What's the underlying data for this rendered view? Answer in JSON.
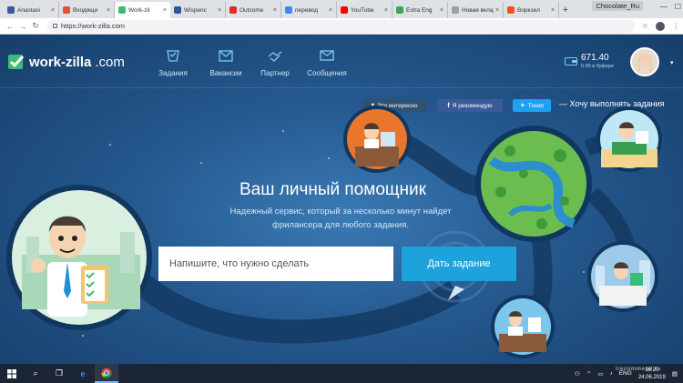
{
  "browser": {
    "tabs": [
      {
        "label": "Anastasi",
        "color": "#3b5998",
        "active": false
      },
      {
        "label": "Входящи",
        "color": "#e2503b",
        "active": false
      },
      {
        "label": "Work-zil",
        "color": "#3dbb76",
        "active": true
      },
      {
        "label": "Wispenc",
        "color": "#2b579a",
        "active": false
      },
      {
        "label": "Outcome",
        "color": "#d93025",
        "active": false
      },
      {
        "label": "перевод",
        "color": "#4285f4",
        "active": false
      },
      {
        "label": "YouTube",
        "color": "#ff0000",
        "active": false
      },
      {
        "label": "Extra Eng",
        "color": "#34a853",
        "active": false
      },
      {
        "label": "Новая вклад",
        "color": "#9aa0a6",
        "active": false
      },
      {
        "label": "Воркзил",
        "color": "#f4511e",
        "active": false
      }
    ],
    "profile_name": "Chocolate_Ru",
    "url": "https://work-zilla.com"
  },
  "site": {
    "logo_name": "work-zilla",
    "logo_suffix": ".com",
    "menu": [
      {
        "label": "Задания",
        "icon": "tasks-icon"
      },
      {
        "label": "Вакансии",
        "icon": "vacancies-icon"
      },
      {
        "label": "Партнер",
        "icon": "partner-icon"
      },
      {
        "label": "Сообщения",
        "icon": "messages-icon"
      }
    ],
    "balance_amount": "671.40",
    "balance_buffer": "0.00 в буфере"
  },
  "social": {
    "interest": "Это интересно",
    "recommend": "Я рекомендую",
    "tweet": "Tweet",
    "want": "— Хочу выполнять задания"
  },
  "hero": {
    "title": "Ваш личный помощник",
    "subtitle": "Надежный сервис, который за несколько минут найдет фрилансера для любого задания.",
    "input_placeholder": "Напишите, что нужно сделать",
    "input_value": "",
    "button_label": "Дать задание"
  },
  "taskbar": {
    "time": "16:20",
    "date": "24.06.2019",
    "language": "ENG"
  },
  "watermark": "irecommend.ru",
  "colors": {
    "accent": "#1ea2dc",
    "brand_green": "#3dbb76",
    "page_bg": "#24588e"
  }
}
